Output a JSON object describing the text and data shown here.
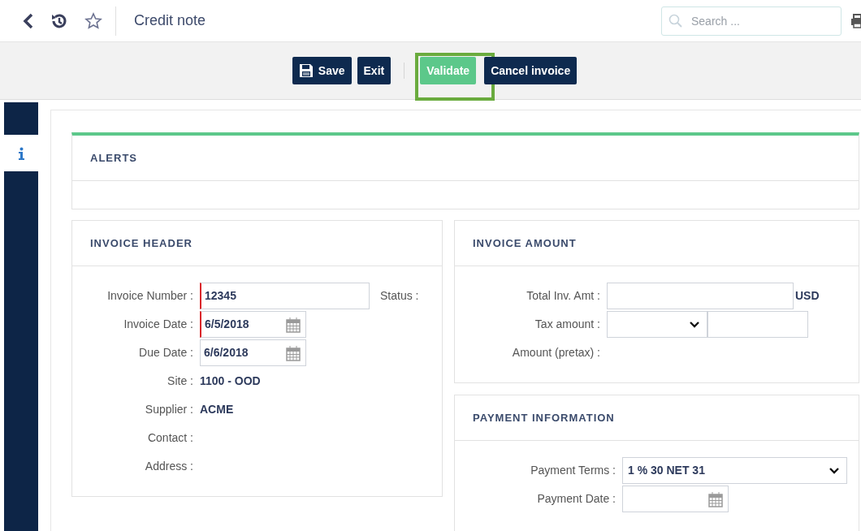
{
  "header": {
    "title": "Credit note",
    "search": {
      "placeholder": "Search ..."
    }
  },
  "toolbar": [
    {
      "label": "Save",
      "kind": "save",
      "highlighted": false
    },
    {
      "label": "Exit",
      "kind": "plain",
      "highlighted": false
    },
    {
      "kind": "divider"
    },
    {
      "label": "Validate",
      "kind": "validate",
      "highlighted": true
    },
    {
      "label": "Cancel invoice",
      "kind": "plain",
      "highlighted": false
    }
  ],
  "side_tabs": [
    {
      "kind": "info",
      "selected": true
    }
  ],
  "alerts": {
    "title": "ALERTS"
  },
  "invoice_header": {
    "title": "INVOICE HEADER",
    "status_label": "Status :",
    "fields": [
      {
        "label": "Invoice Number :",
        "kind": "input",
        "value": "12345",
        "required": true
      },
      {
        "label": "Invoice Date :",
        "kind": "date",
        "value": "6/5/2018",
        "required": true
      },
      {
        "label": "Due Date :",
        "kind": "date",
        "value": "6/6/2018",
        "required": false
      },
      {
        "label": "Site :",
        "kind": "text",
        "value": "1100 - OOD"
      },
      {
        "label": "Supplier :",
        "kind": "text",
        "value": "ACME"
      },
      {
        "label": "Contact :",
        "kind": "text"
      },
      {
        "label": "Address :",
        "kind": "text"
      }
    ]
  },
  "invoice_amount": {
    "title": "INVOICE AMOUNT",
    "fields": [
      {
        "label": "Total Inv. Amt :",
        "kind": "input",
        "suffix": "USD"
      },
      {
        "label": "Tax amount :",
        "kind": "select_input"
      },
      {
        "label": "Amount (pretax) :",
        "kind": "text"
      }
    ]
  },
  "payment_information": {
    "title": "PAYMENT INFORMATION",
    "fields": [
      {
        "label": "Payment Terms :",
        "kind": "select",
        "value": "1 % 30 NET 31"
      },
      {
        "label": "Payment Date :",
        "kind": "date"
      }
    ]
  }
}
